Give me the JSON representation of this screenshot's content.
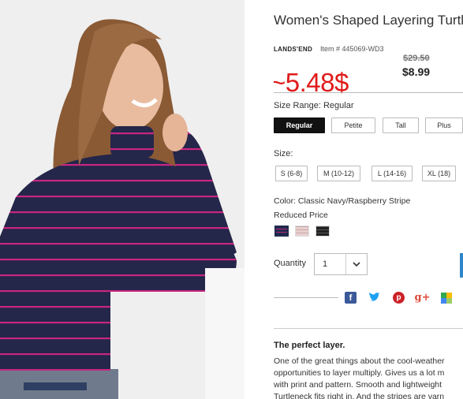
{
  "product": {
    "title": "Women's Shaped Layering Turtleneck",
    "brand": "LANDS'END",
    "item_number": "Item # 445069-WD3",
    "original_price": "$29.50",
    "sale_price": "$8.99",
    "overlay_price": "~5.48$"
  },
  "size_range": {
    "label": "Size Range: Regular",
    "options": [
      "Regular",
      "Petite",
      "Tall",
      "Plus"
    ],
    "selected": "Regular"
  },
  "size": {
    "label": "Size:",
    "options": [
      "S (6-8)",
      "M (10-12)",
      "L (14-16)",
      "XL (18)"
    ]
  },
  "color": {
    "label": "Color: Classic Navy/Raspberry Stripe",
    "note": "Reduced Price",
    "swatches": [
      {
        "name": "navy-raspberry-stripe",
        "color": "#1f2a4d",
        "accent": "#c0257a"
      },
      {
        "name": "pink-stripe",
        "color": "#e8cfcf",
        "accent": "#c9a7a7"
      },
      {
        "name": "black-stripe",
        "color": "#222222",
        "accent": "#555555"
      }
    ]
  },
  "quantity": {
    "label": "Quantity",
    "value": "1"
  },
  "share": {
    "icons": [
      "facebook-icon",
      "twitter-icon",
      "pinterest-icon",
      "google-plus-icon",
      "color-squares-icon"
    ],
    "colors": {
      "facebook": "#3b5998",
      "twitter": "#1da1f2",
      "pinterest": "#cb2027",
      "google_plus": "#dd4b39"
    }
  },
  "description": {
    "heading": "The perfect layer.",
    "lines": [
      "One of the great things about the cool-weather",
      "opportunities to layer multiply. Gives us a lot m",
      "with print and pattern. Smooth and lightweight",
      "Turtleneck fits right in. And the stripes are varn"
    ]
  }
}
